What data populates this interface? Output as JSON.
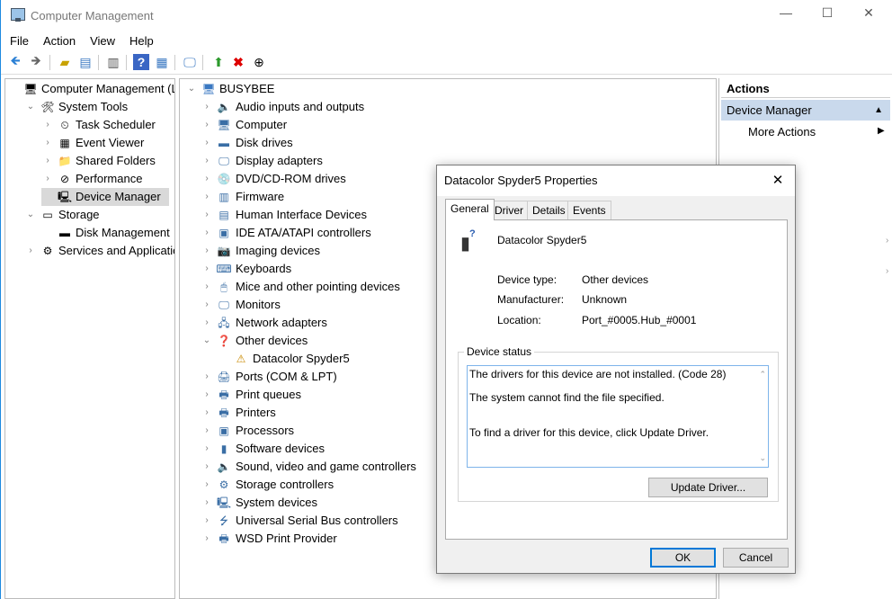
{
  "window": {
    "title": "Computer Management",
    "minimize": "—",
    "maximize": "☐",
    "close": "✕"
  },
  "menu": [
    "File",
    "Action",
    "View",
    "Help"
  ],
  "tree": [
    {
      "label": "Computer Management (Lo",
      "depth": 0,
      "chev": "",
      "icon": "computer-management-icon",
      "glyph": "🖥"
    },
    {
      "label": "System Tools",
      "depth": 1,
      "chev": "⌄",
      "icon": "tools-icon",
      "glyph": "🛠"
    },
    {
      "label": "Task Scheduler",
      "depth": 2,
      "chev": "›",
      "icon": "clock-icon",
      "glyph": "⏲"
    },
    {
      "label": "Event Viewer",
      "depth": 2,
      "chev": "›",
      "icon": "event-viewer-icon",
      "glyph": "▦"
    },
    {
      "label": "Shared Folders",
      "depth": 2,
      "chev": "›",
      "icon": "shared-folder-icon",
      "glyph": "📁"
    },
    {
      "label": "Performance",
      "depth": 2,
      "chev": "›",
      "icon": "performance-icon",
      "glyph": "⊘"
    },
    {
      "label": "Device Manager",
      "depth": 2,
      "chev": "",
      "icon": "device-manager-icon",
      "glyph": "🖳",
      "selected": true
    },
    {
      "label": "Storage",
      "depth": 1,
      "chev": "⌄",
      "icon": "storage-icon",
      "glyph": "▭"
    },
    {
      "label": "Disk Management",
      "depth": 2,
      "chev": "",
      "icon": "disk-icon",
      "glyph": "▬"
    },
    {
      "label": "Services and Application",
      "depth": 1,
      "chev": "›",
      "icon": "services-icon",
      "glyph": "⚙"
    }
  ],
  "devices": {
    "root": "BUSYBEE",
    "items": [
      {
        "label": "Audio inputs and outputs",
        "chev": "›",
        "icon": "speaker-icon",
        "glyph": "🔈"
      },
      {
        "label": "Computer",
        "chev": "›",
        "icon": "computer-icon",
        "glyph": "🖥"
      },
      {
        "label": "Disk drives",
        "chev": "›",
        "icon": "disk-drive-icon",
        "glyph": "▬"
      },
      {
        "label": "Display adapters",
        "chev": "›",
        "icon": "display-adapter-icon",
        "glyph": "🖵"
      },
      {
        "label": "DVD/CD-ROM drives",
        "chev": "›",
        "icon": "dvd-icon",
        "glyph": "💿"
      },
      {
        "label": "Firmware",
        "chev": "›",
        "icon": "firmware-icon",
        "glyph": "▥"
      },
      {
        "label": "Human Interface Devices",
        "chev": "›",
        "icon": "hid-icon",
        "glyph": "▤"
      },
      {
        "label": "IDE ATA/ATAPI controllers",
        "chev": "›",
        "icon": "ide-controller-icon",
        "glyph": "▣"
      },
      {
        "label": "Imaging devices",
        "chev": "›",
        "icon": "camera-icon",
        "glyph": "📷"
      },
      {
        "label": "Keyboards",
        "chev": "›",
        "icon": "keyboard-icon",
        "glyph": "⌨"
      },
      {
        "label": "Mice and other pointing devices",
        "chev": "›",
        "icon": "mouse-icon",
        "glyph": "🖱"
      },
      {
        "label": "Monitors",
        "chev": "›",
        "icon": "monitor-icon",
        "glyph": "🖵"
      },
      {
        "label": "Network adapters",
        "chev": "›",
        "icon": "network-icon",
        "glyph": "🖧"
      },
      {
        "label": "Other devices",
        "chev": "⌄",
        "icon": "unknown-device-icon",
        "glyph": "❓"
      },
      {
        "label": "Datacolor Spyder5",
        "chev": "",
        "icon": "warning-device-icon",
        "glyph": "⚠",
        "child": true
      },
      {
        "label": "Ports (COM & LPT)",
        "chev": "›",
        "icon": "port-icon",
        "glyph": "🖨"
      },
      {
        "label": "Print queues",
        "chev": "›",
        "icon": "print-queue-icon",
        "glyph": "🖶"
      },
      {
        "label": "Printers",
        "chev": "›",
        "icon": "printer-icon",
        "glyph": "🖶"
      },
      {
        "label": "Processors",
        "chev": "›",
        "icon": "processor-icon",
        "glyph": "▣"
      },
      {
        "label": "Software devices",
        "chev": "›",
        "icon": "software-device-icon",
        "glyph": "▮"
      },
      {
        "label": "Sound, video and game controllers",
        "chev": "›",
        "icon": "sound-icon",
        "glyph": "🔈"
      },
      {
        "label": "Storage controllers",
        "chev": "›",
        "icon": "storage-controller-icon",
        "glyph": "⚙"
      },
      {
        "label": "System devices",
        "chev": "›",
        "icon": "system-device-icon",
        "glyph": "🖳"
      },
      {
        "label": "Universal Serial Bus controllers",
        "chev": "›",
        "icon": "usb-icon",
        "glyph": "⭍"
      },
      {
        "label": "WSD Print Provider",
        "chev": "›",
        "icon": "wsd-printer-icon",
        "glyph": "🖶"
      }
    ]
  },
  "actions": {
    "header": "Actions",
    "section": "Device Manager",
    "more": "More Actions"
  },
  "dialog": {
    "title": "Datacolor Spyder5 Properties",
    "tabs": [
      "General",
      "Driver",
      "Details",
      "Events"
    ],
    "device_name": "Datacolor Spyder5",
    "fields": [
      {
        "label": "Device type:",
        "value": "Other devices"
      },
      {
        "label": "Manufacturer:",
        "value": "Unknown"
      },
      {
        "label": "Location:",
        "value": "Port_#0005.Hub_#0001"
      }
    ],
    "status_label": "Device status",
    "status_lines": [
      "The drivers for this device are not installed. (Code 28)",
      "The system cannot find the file specified.",
      "To find a driver for this device, click Update Driver."
    ],
    "update_button": "Update Driver...",
    "ok": "OK",
    "cancel": "Cancel"
  },
  "colors": {
    "accent": "#0078d7",
    "selection": "#d9d9d9",
    "actions_header": "#c9d9ec"
  }
}
